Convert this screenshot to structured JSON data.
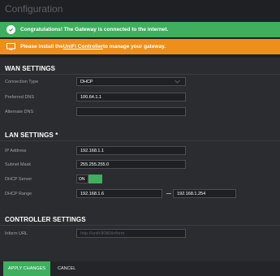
{
  "page": {
    "title": "Configuration"
  },
  "banners": {
    "success": {
      "text": "Congratulations! The Gateway is connected to the internet."
    },
    "warning": {
      "prefix": "Please install the ",
      "link": "UniFi Controller",
      "suffix": " to manage your gateway."
    }
  },
  "wan": {
    "heading": "WAN SETTINGS",
    "connection_type_label": "Connection Type",
    "connection_type_value": "DHCP",
    "preferred_dns_label": "Preferred DNS",
    "preferred_dns_value": "100.64.1.1",
    "alternate_dns_label": "Alternate DNS",
    "alternate_dns_value": ""
  },
  "lan": {
    "heading": "LAN SETTINGS *",
    "ip_label": "IP Address",
    "ip_value": "192.168.1.1",
    "subnet_label": "Subnet Mask",
    "subnet_value": "255.255.255.0",
    "dhcp_server_label": "DHCP Server",
    "dhcp_server_state": "ON",
    "dhcp_range_label": "DHCP Range",
    "dhcp_range_start": "192.168.1.6",
    "dhcp_range_end": "192.168.1.254"
  },
  "controller": {
    "heading": "CONTROLLER SETTINGS",
    "inform_label": "Inform URL",
    "inform_placeholder": "http://unifi:8080/inform"
  },
  "footer": {
    "apply_label": "APPLY CHANGES",
    "cancel_label": "CANCEL"
  },
  "colors": {
    "accent": "#3fae5f",
    "warning": "#ee8f1c",
    "background": "#2a2c2f"
  }
}
